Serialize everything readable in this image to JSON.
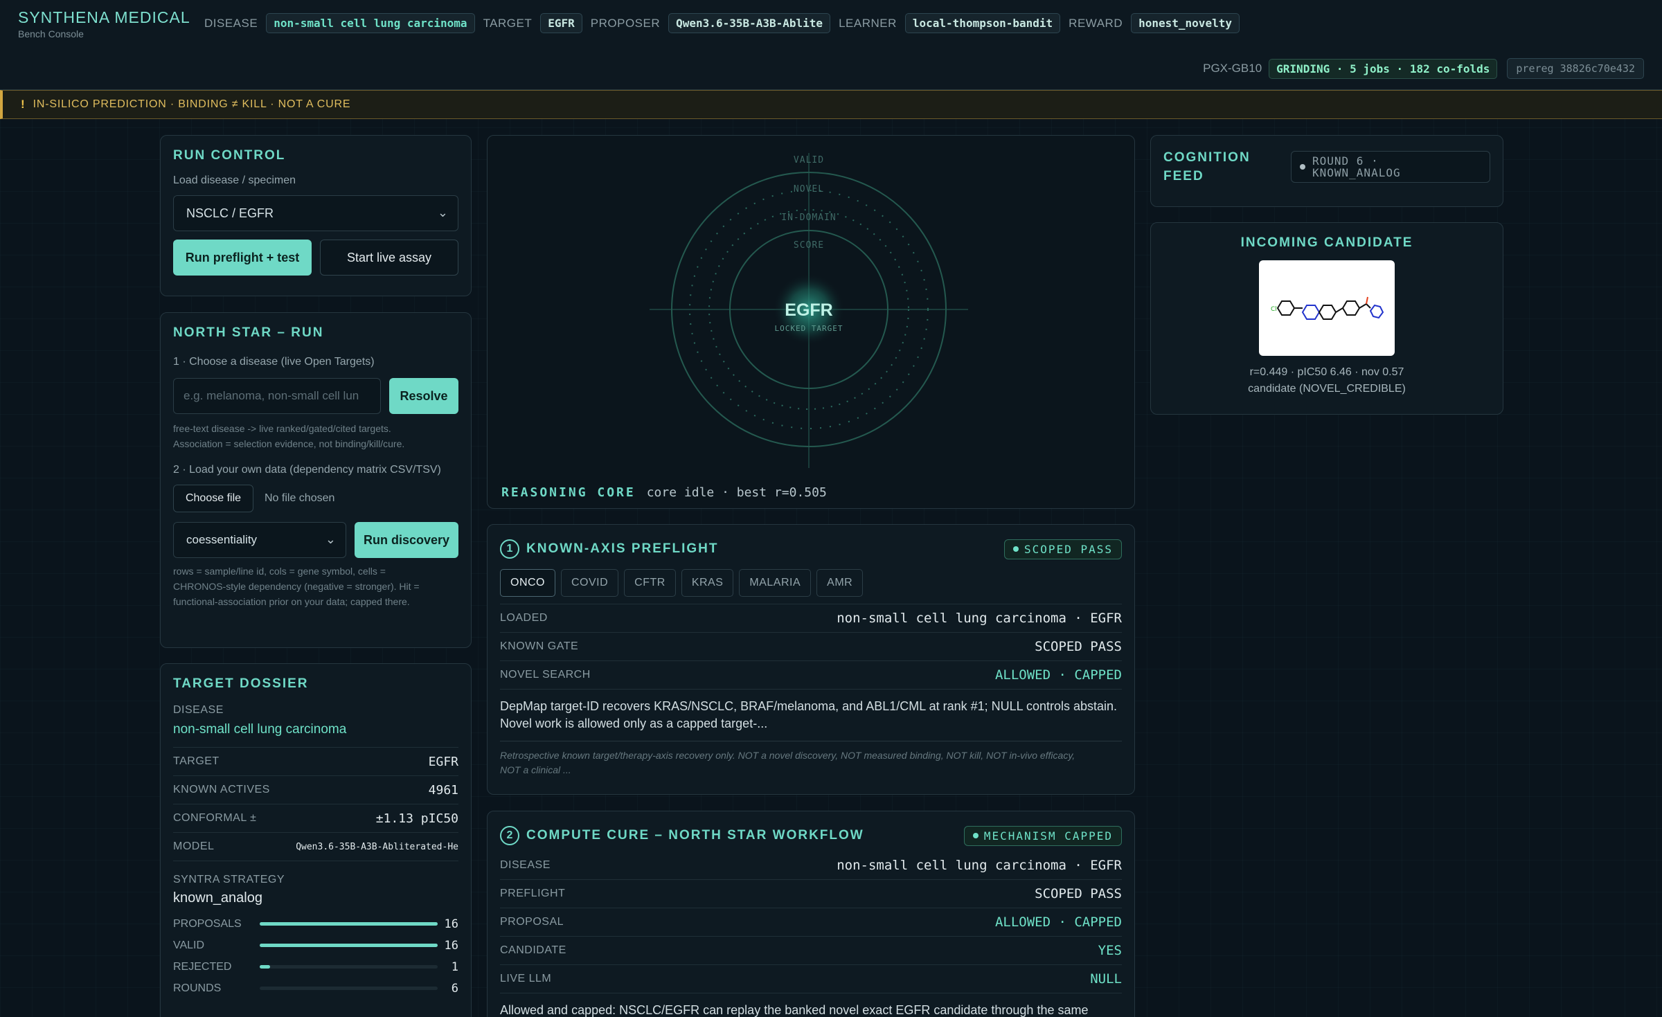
{
  "brand": {
    "name": "SYNTHENA MEDICAL",
    "subtitle": "Bench Console"
  },
  "header": {
    "meta": [
      {
        "label": "DISEASE",
        "value": "non-small cell lung carcinoma"
      },
      {
        "label": "TARGET",
        "value": "EGFR"
      },
      {
        "label": "PROPOSER",
        "value": "Qwen3.6-35B-A3B-Ablite"
      },
      {
        "label": "LEARNER",
        "value": "local-thompson-bandit"
      },
      {
        "label": "REWARD",
        "value": "honest_novelty"
      }
    ],
    "gpu_label": "PGX-GB10",
    "grinding": "GRINDING · 5 jobs · 182 co-folds",
    "prereg": "prereg 38826c70e432"
  },
  "warning": {
    "icon": "!",
    "text": "IN-SILICO PREDICTION · BINDING ≠ KILL · NOT A CURE"
  },
  "run_control": {
    "title": "RUN CONTROL",
    "load_label": "Load disease / specimen",
    "selected": "NSCLC / EGFR",
    "primary_button": "Run preflight + test",
    "secondary_button": "Start live assay"
  },
  "north_star": {
    "title": "NORTH STAR – RUN",
    "step1": "1 · Choose a disease (live Open Targets)",
    "disease_placeholder": "e.g. melanoma, non-small cell lun",
    "resolve_button": "Resolve",
    "help1": "free-text disease -> live ranked/gated/cited targets.",
    "help2": "Association = selection evidence, not binding/kill/cure.",
    "step2": "2 · Load your own data (dependency matrix CSV/TSV)",
    "choose_file": "Choose file",
    "no_file": "No file chosen",
    "method": "coessentiality",
    "run_discovery": "Run discovery",
    "help3": "rows = sample/line id, cols = gene symbol, cells =",
    "help4": "CHRONOS-style dependency (negative = stronger). Hit =",
    "help5": "functional-association prior on your data; capped there."
  },
  "dossier": {
    "title": "TARGET DOSSIER",
    "disease_label": "DISEASE",
    "disease_value": "non-small cell lung carcinoma",
    "rows": [
      {
        "label": "TARGET",
        "value": "EGFR"
      },
      {
        "label": "KNOWN ACTIVES",
        "value": "4961"
      },
      {
        "label": "CONFORMAL ±",
        "value": "±1.13 pIC50"
      },
      {
        "label": "MODEL",
        "value": "Qwen3.6-35B-A3B-Abliterated-He"
      }
    ],
    "strategy_label": "SYNTRA STRATEGY",
    "strategy_value": "known_analog",
    "bars": [
      {
        "label": "PROPOSALS",
        "value": "16",
        "fill": 1.0
      },
      {
        "label": "VALID",
        "value": "16",
        "fill": 1.0
      },
      {
        "label": "REJECTED",
        "value": "1",
        "fill": 0.06
      },
      {
        "label": "ROUNDS",
        "value": "6",
        "fill": 0.0
      }
    ]
  },
  "reasoning_core": {
    "rings": [
      "VALID",
      "NOVEL",
      "IN-DOMAIN",
      "SCORE"
    ],
    "center": "EGFR",
    "center_sub": "LOCKED TARGET",
    "title": "REASONING CORE",
    "status": "core idle · best r=0.505"
  },
  "preflight": {
    "num": "1",
    "title": "KNOWN-AXIS PREFLIGHT",
    "badge": "SCOPED PASS",
    "tabs": [
      "ONCO",
      "COVID",
      "CFTR",
      "KRAS",
      "MALARIA",
      "AMR"
    ],
    "active_tab": "ONCO",
    "rows": [
      {
        "label": "LOADED",
        "value": "non-small cell lung carcinoma · EGFR"
      },
      {
        "label": "KNOWN GATE",
        "value": "SCOPED PASS"
      },
      {
        "label": "NOVEL SEARCH",
        "value": "ALLOWED · CAPPED"
      }
    ],
    "para1": "DepMap target-ID recovers KRAS/NSCLC, BRAF/melanoma, and ABL1/CML at rank #1; NULL controls abstain.",
    "para2": "Novel work is allowed only as a capped target-...",
    "note1": "Retrospective known target/therapy-axis recovery only. NOT a novel discovery, NOT measured binding, NOT kill, NOT in-vivo efficacy,",
    "note2": "NOT a clinical ..."
  },
  "cure": {
    "num": "2",
    "title": "COMPUTE CURE – NORTH STAR WORKFLOW",
    "badge": "MECHANISM CAPPED",
    "rows": [
      {
        "label": "DISEASE",
        "value": "non-small cell lung carcinoma · EGFR"
      },
      {
        "label": "PREFLIGHT",
        "value": "SCOPED PASS"
      },
      {
        "label": "PROPOSAL",
        "value": "ALLOWED · CAPPED"
      },
      {
        "label": "CANDIDATE",
        "value": "YES"
      },
      {
        "label": "LIVE LLM",
        "value": "NULL"
      }
    ],
    "para": "Allowed and capped: NSCLC/EGFR can replay the banked novel exact EGFR candidate through the same"
  },
  "cognition": {
    "title1": "COGNITION",
    "title2": "FEED",
    "round_line1": "ROUND 6 ·",
    "round_line2": "KNOWN_ANALOG"
  },
  "incoming": {
    "title": "INCOMING CANDIDATE",
    "metrics": "r=0.449 · pIC50 6.46 · nov 0.57",
    "verdict": "candidate (NOVEL_CREDIBLE)"
  }
}
